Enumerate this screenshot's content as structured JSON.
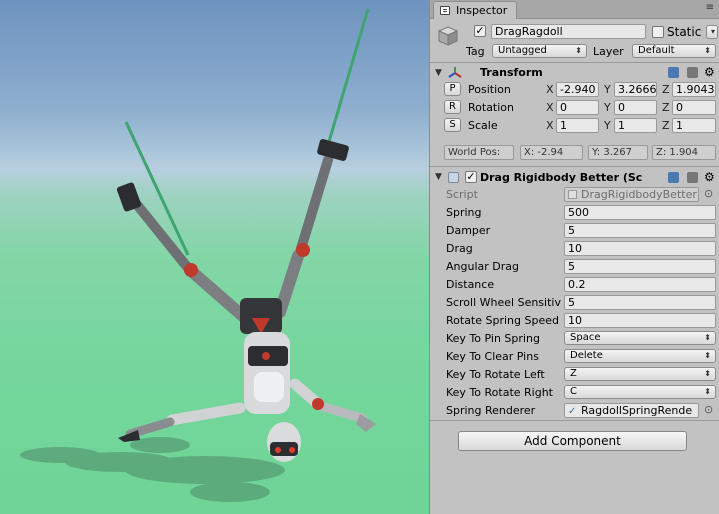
{
  "tab": {
    "title": "Inspector",
    "icon": "inspector-icon",
    "controls": "≡"
  },
  "gameobject": {
    "name": "DragRagdoll",
    "static_label": "Static",
    "tag_label": "Tag",
    "tag_value": "Untagged",
    "layer_label": "Layer",
    "layer_value": "Default"
  },
  "transform": {
    "title": "Transform",
    "position_label": "Position",
    "rotation_label": "Rotation",
    "scale_label": "Scale",
    "position_btn": "P",
    "rotation_btn": "R",
    "scale_btn": "S",
    "axes": {
      "x": "X",
      "y": "Y",
      "z": "Z"
    },
    "position": {
      "x": "-2.940",
      "y": "3.2666",
      "z": "1.9043"
    },
    "rotation": {
      "x": "0",
      "y": "0",
      "z": "0"
    },
    "scale": {
      "x": "1",
      "y": "1",
      "z": "1"
    },
    "world_pos_label": "World Pos:",
    "world_x": "X: -2.94",
    "world_y": "Y: 3.267",
    "world_z": "Z: 1.904"
  },
  "component": {
    "title": "Drag Rigidbody Better (Sc",
    "script_label": "Script",
    "script_value": "DragRigidbodyBetter",
    "fields": [
      {
        "label": "Spring",
        "value": "500"
      },
      {
        "label": "Damper",
        "value": "5"
      },
      {
        "label": "Drag",
        "value": "10"
      },
      {
        "label": "Angular Drag",
        "value": "5"
      },
      {
        "label": "Distance",
        "value": "0.2"
      },
      {
        "label": "Scroll Wheel Sensitiv",
        "value": "5"
      },
      {
        "label": "Rotate Spring Speed",
        "value": "10"
      }
    ],
    "dropdowns": [
      {
        "label": "Key To Pin Spring",
        "value": "Space"
      },
      {
        "label": "Key To Clear Pins",
        "value": "Delete"
      },
      {
        "label": "Key To Rotate Left",
        "value": "Z"
      },
      {
        "label": "Key To Rotate Right",
        "value": "C"
      }
    ],
    "spring_renderer_label": "Spring Renderer",
    "spring_renderer_value": "RagdollSpringRende"
  },
  "add_component_label": "Add Component",
  "colors": {
    "panel_bg": "#c2c2c2",
    "spring_line": "#3fa570",
    "robot_red": "#c0392b"
  }
}
